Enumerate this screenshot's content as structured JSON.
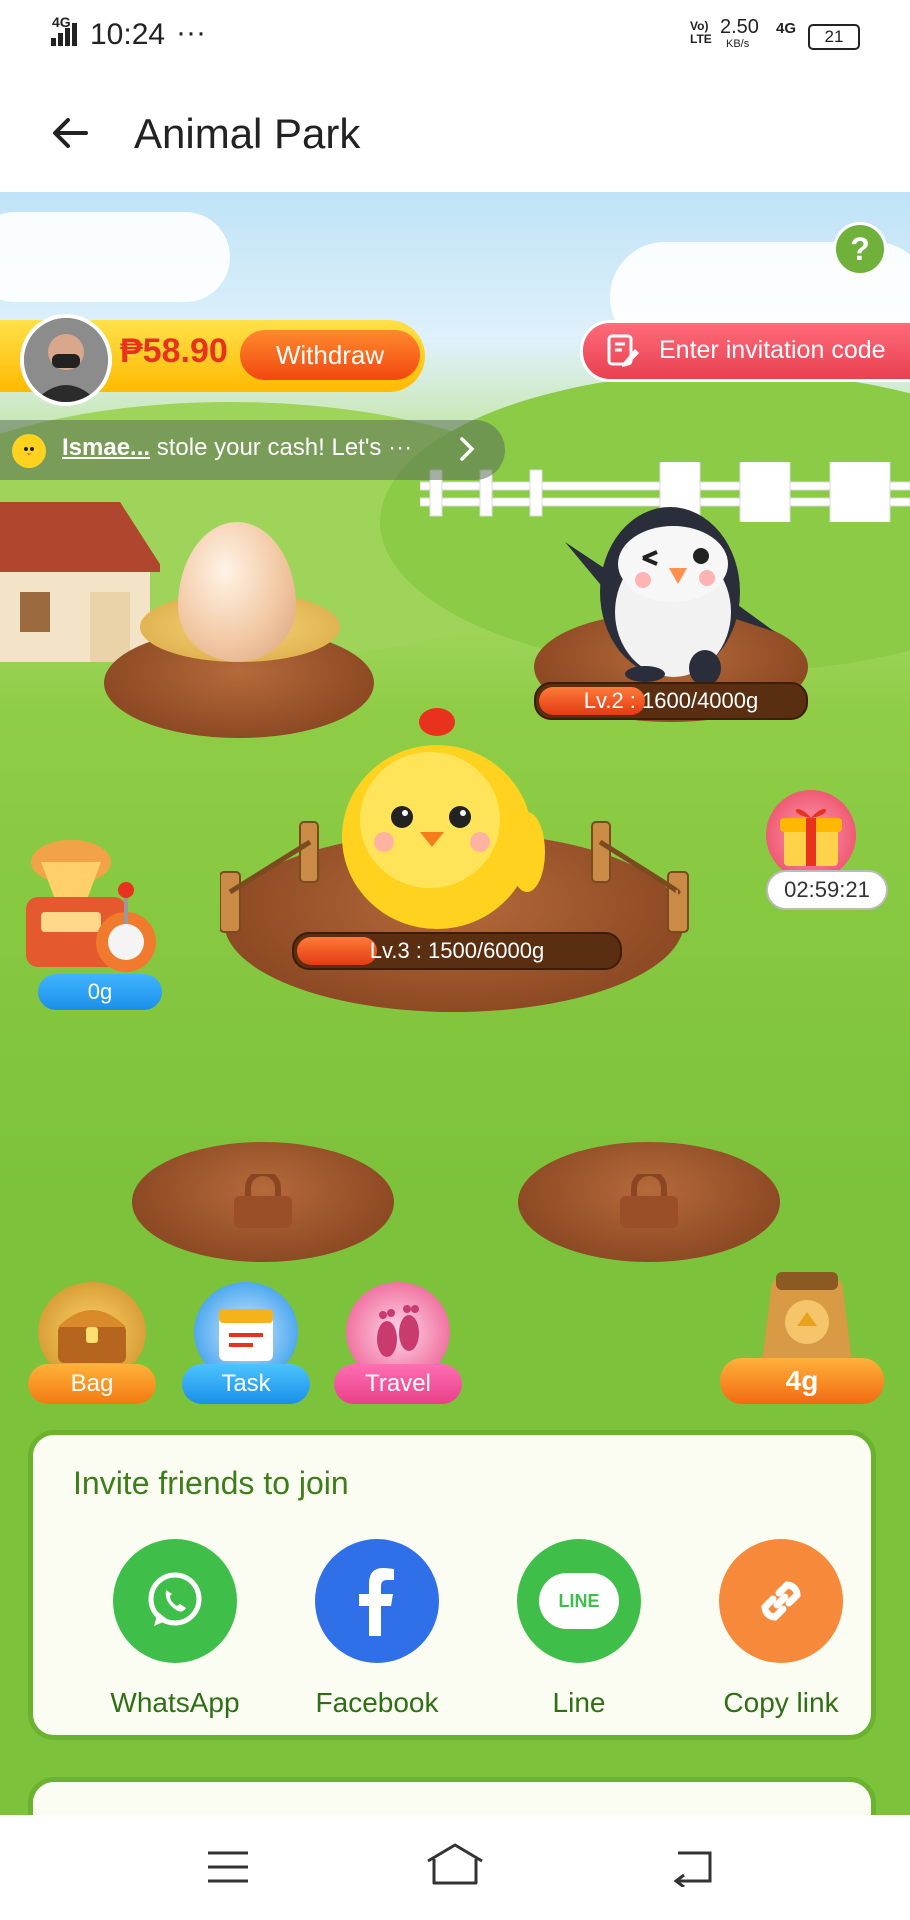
{
  "status_bar": {
    "network_left": "4G",
    "time": "10:24",
    "more_dots": "···",
    "volte": "Vo) LTE",
    "speed": "2.50",
    "speed_unit": "KB/s",
    "network_right": "4G",
    "battery": "21"
  },
  "app_bar": {
    "title": "Animal Park"
  },
  "header": {
    "balance": "₱58.90",
    "withdraw_label": "Withdraw",
    "invite_code_label": "Enter invitation code",
    "help_label": "?"
  },
  "notice": {
    "user": "Ismae...",
    "text": " stole your cash! Let's ···"
  },
  "animals": {
    "penguin": {
      "level_text": "Lv.2 : 1600/4000g",
      "progress": 0.4
    },
    "chick": {
      "level_text": "Lv.3 : 1500/6000g",
      "progress": 0.25
    }
  },
  "feeder": {
    "amount": "0g"
  },
  "gift": {
    "timer": "02:59:21"
  },
  "actions": {
    "bag_label": "Bag",
    "task_label": "Task",
    "travel_label": "Travel",
    "feed_amount": "4g"
  },
  "invite": {
    "title": "Invite friends to join",
    "options": [
      {
        "label": "WhatsApp",
        "color": "#3fbf4a"
      },
      {
        "label": "Facebook",
        "color": "#2f6fe8"
      },
      {
        "label": "Line",
        "color": "#3fbf4a",
        "badge": "LINE"
      },
      {
        "label": "Copy link",
        "color": "#f7893a"
      }
    ]
  },
  "colors": {
    "accent_orange": "#ff6a1a",
    "red_price": "#e8321d",
    "green_card": "#6bb22e"
  }
}
